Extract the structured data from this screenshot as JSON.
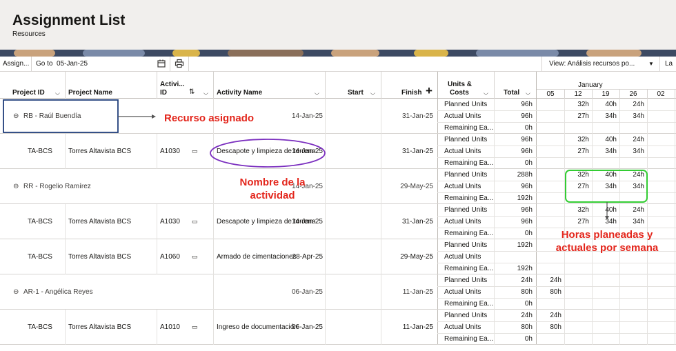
{
  "page": {
    "title": "Assignment List",
    "subtitle": "Resources"
  },
  "toolbar": {
    "assign_label": "Assign...",
    "goto_label": "Go to",
    "goto_value": "05-Jan-25",
    "view_value": "View: Análisis recursos po...",
    "layout_label": "La"
  },
  "columns": {
    "project_id": "Project ID",
    "project_name": "Project Name",
    "activity_id_line1": "Activi...",
    "activity_id_line2": "ID",
    "activity_name": "Activity Name",
    "start": "Start",
    "finish": "Finish",
    "units_costs_line1": "Units &",
    "units_costs_line2": "Costs",
    "total": "Total",
    "month": "January",
    "weeks": [
      "05",
      "12",
      "19",
      "26",
      "02"
    ]
  },
  "unit_labels": [
    "Planned Units",
    "Actual Units",
    "Remaining Ea..."
  ],
  "rows": [
    {
      "type": "resource",
      "name": "RB - Raúl Buendía",
      "start": "14-Jan-25",
      "finish": "31-Jan-25",
      "totals": [
        "96h",
        "96h",
        "0h"
      ],
      "weekly": [
        [
          "",
          "32h",
          "40h",
          "24h",
          ""
        ],
        [
          "",
          "27h",
          "34h",
          "34h",
          ""
        ],
        [
          "",
          "",
          "",
          "",
          ""
        ]
      ]
    },
    {
      "type": "activity",
      "project_id": "TA-BCS",
      "project_name": "Torres Altavista BCS",
      "activity_id": "A1030",
      "activity_name": "Descapote y limpieza de terreno",
      "start": "14-Jan-25",
      "finish": "31-Jan-25",
      "totals": [
        "96h",
        "96h",
        "0h"
      ],
      "weekly": [
        [
          "",
          "32h",
          "40h",
          "24h",
          ""
        ],
        [
          "",
          "27h",
          "34h",
          "34h",
          ""
        ],
        [
          "",
          "",
          "",
          "",
          ""
        ]
      ]
    },
    {
      "type": "resource",
      "name": "RR - Rogelio Ramírez",
      "start": "14-Jan-25",
      "finish": "29-May-25",
      "totals": [
        "288h",
        "96h",
        "192h"
      ],
      "weekly": [
        [
          "",
          "32h",
          "40h",
          "24h",
          ""
        ],
        [
          "",
          "27h",
          "34h",
          "34h",
          ""
        ],
        [
          "",
          "",
          "",
          "",
          ""
        ]
      ]
    },
    {
      "type": "activity",
      "project_id": "TA-BCS",
      "project_name": "Torres Altavista BCS",
      "activity_id": "A1030",
      "activity_name": "Descapote y limpieza de terreno",
      "start": "14-Jan-25",
      "finish": "31-Jan-25",
      "totals": [
        "96h",
        "96h",
        "0h"
      ],
      "weekly": [
        [
          "",
          "32h",
          "40h",
          "24h",
          ""
        ],
        [
          "",
          "27h",
          "34h",
          "34h",
          ""
        ],
        [
          "",
          "",
          "",
          "",
          ""
        ]
      ]
    },
    {
      "type": "activity",
      "project_id": "TA-BCS",
      "project_name": "Torres Altavista BCS",
      "activity_id": "A1060",
      "activity_name": "Armado de cimentaciones",
      "start": "28-Apr-25",
      "finish": "29-May-25",
      "totals": [
        "192h",
        "",
        "192h"
      ],
      "weekly": [
        [
          "",
          "",
          "",
          "",
          ""
        ],
        [
          "",
          "",
          "",
          "",
          ""
        ],
        [
          "",
          "",
          "",
          "",
          ""
        ]
      ]
    },
    {
      "type": "resource",
      "name": "AR-1 - Angélica Reyes",
      "start": "06-Jan-25",
      "finish": "11-Jan-25",
      "totals": [
        "24h",
        "80h",
        "0h"
      ],
      "weekly": [
        [
          "24h",
          "",
          "",
          "",
          ""
        ],
        [
          "80h",
          "",
          "",
          "",
          ""
        ],
        [
          "",
          "",
          "",
          "",
          ""
        ]
      ]
    },
    {
      "type": "activity",
      "project_id": "TA-BCS",
      "project_name": "Torres Altavista BCS",
      "activity_id": "A1010",
      "activity_name": "Ingreso de documentación",
      "start": "06-Jan-25",
      "finish": "11-Jan-25",
      "totals": [
        "24h",
        "80h",
        "0h"
      ],
      "weekly": [
        [
          "24h",
          "",
          "",
          "",
          ""
        ],
        [
          "80h",
          "",
          "",
          "",
          ""
        ],
        [
          "",
          "",
          "",
          "",
          ""
        ]
      ]
    }
  ],
  "annotations": {
    "resource": "Recurso asignado",
    "activity_line1": "Nombre de la",
    "activity_line2": "actividad",
    "hours_line1": "Horas planeadas y",
    "hours_line2": "actuales por semana"
  },
  "colors": {
    "annotation_red": "#e3261c",
    "box_navy": "#1f3d7a",
    "ellipse_purple": "#7b2fbf",
    "box_green": "#33cc33"
  }
}
